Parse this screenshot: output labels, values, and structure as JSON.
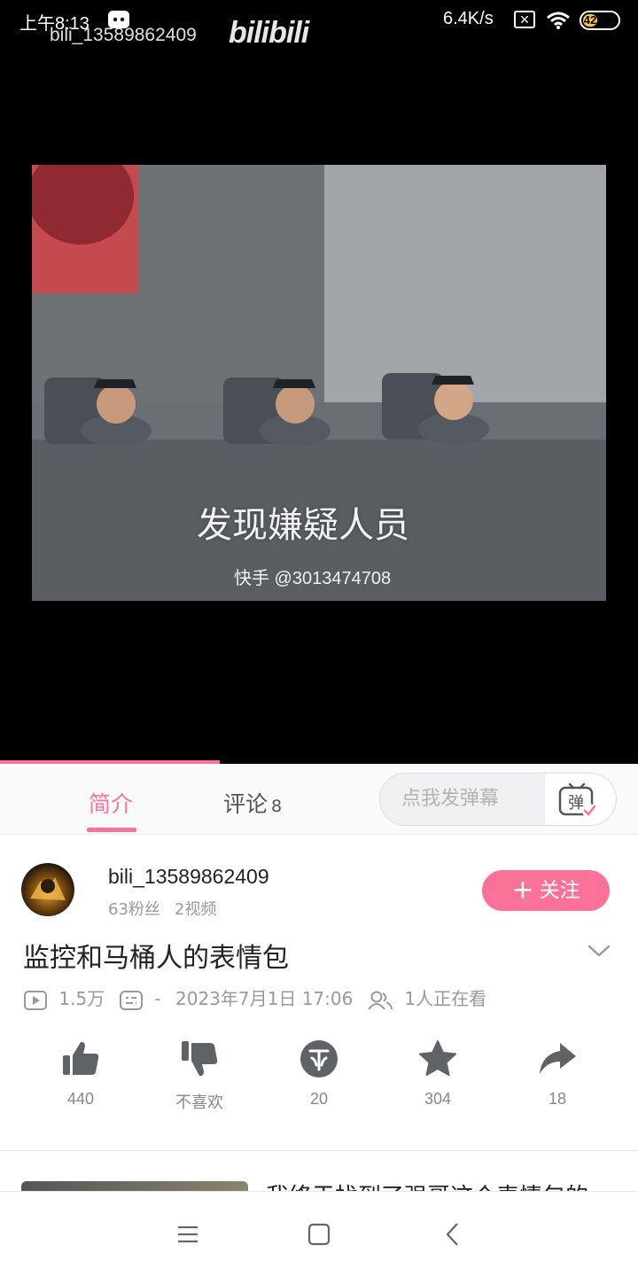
{
  "status_bar": {
    "time": "上午8:13",
    "net_speed": "6.4K/s",
    "battery": "42",
    "icons": [
      "app-notification-icon",
      "no-sim-icon",
      "wifi-icon",
      "battery-icon"
    ]
  },
  "watermark": {
    "user": "bili_13589862409",
    "logo": "bilibili"
  },
  "video": {
    "subtitle": "发现嫌疑人员",
    "credit": "快手 @3013474708",
    "progress": 0.345
  },
  "tabs": {
    "intro": "简介",
    "comments": "评论",
    "comments_count": "8",
    "danmaku_placeholder": "点我发弹幕",
    "danmaku_button": "弹"
  },
  "uploader": {
    "name": "bili_13589862409",
    "fans": "63粉丝",
    "videos": "2视频",
    "follow": "关注"
  },
  "video_info": {
    "title": "监控和马桶人的表情包",
    "views": "1.5万",
    "danmaku_count": "-",
    "date": "2023年7月1日 17:06",
    "watching": "1人正在看"
  },
  "actions": {
    "like": "440",
    "dislike": "不喜欢",
    "coin": "20",
    "favorite": "304",
    "share": "18"
  },
  "recommendation": {
    "title": "我终于找到了强哥这个表情包的"
  },
  "colors": {
    "accent": "#fb7299",
    "icon_gray": "#5f6368"
  }
}
